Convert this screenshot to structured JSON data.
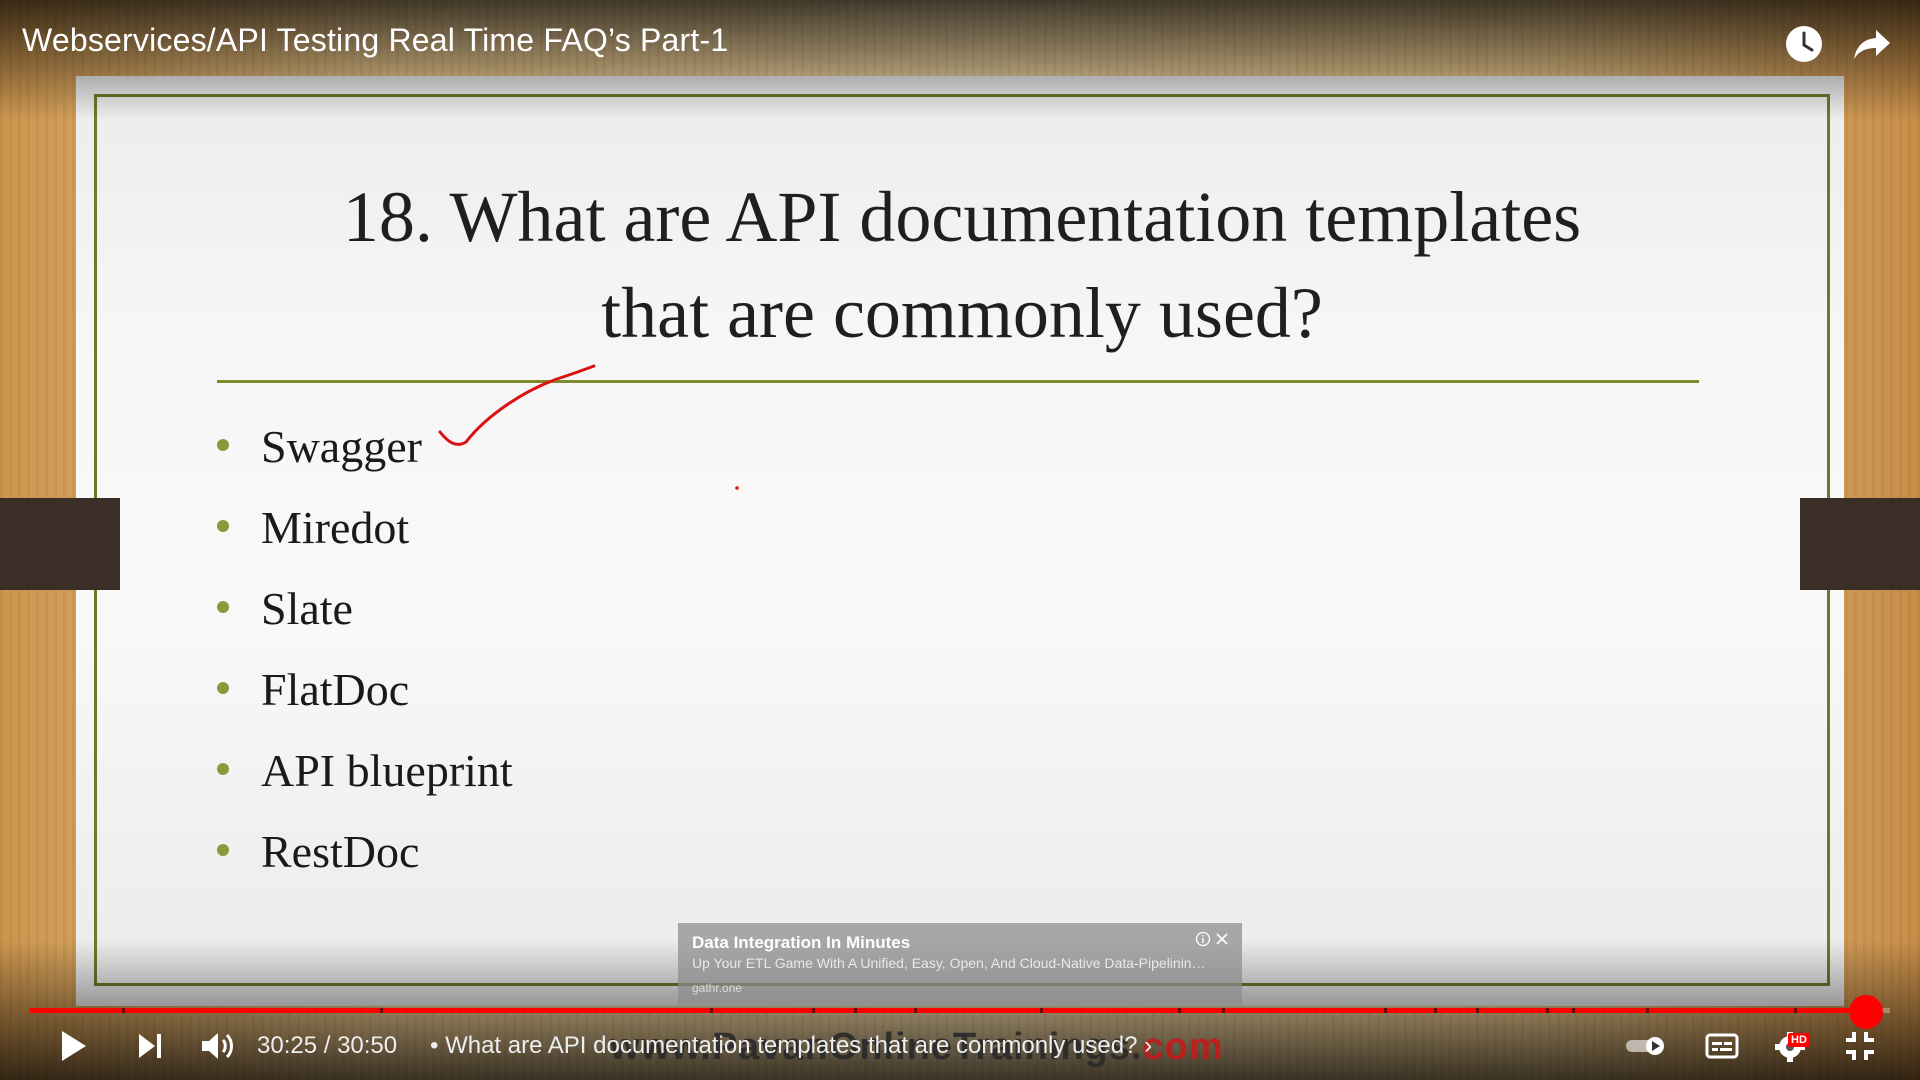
{
  "video": {
    "title": "Webservices/API Testing Real Time FAQ’s Part-1"
  },
  "slide": {
    "title_line1": "18. What are API documentation templates",
    "title_line2": "that are commonly used?",
    "bullets": [
      "Swagger",
      "Miredot",
      "Slate",
      "FlatDoc",
      "API blueprint",
      "RestDoc"
    ]
  },
  "ad": {
    "title": "Data Integration In Minutes",
    "description": "Up Your ETL Game With A Unified, Easy, Open, And Cloud-Native Data-Pipelining Platform.",
    "source": "gathr.one"
  },
  "player": {
    "time": "30:25 / 30:50",
    "chapter": "• What are API documentation templates that are commonly used?",
    "chapter_arrow": "›",
    "progress": 0.984,
    "accent_color": "#ff0000",
    "hd_label": "HD"
  },
  "watermark": {
    "text_main": "www.PavanOnlineTrainings.",
    "text_end": "com"
  },
  "icons": {
    "watch_later": "clock-icon",
    "share": "share-arrow-icon",
    "play": "play-icon",
    "next": "next-icon",
    "volume": "volume-icon",
    "autoplay": "autoplay-toggle-icon",
    "captions": "captions-icon",
    "settings": "gear-icon",
    "fullscreen_exit": "exit-fullscreen-icon"
  }
}
